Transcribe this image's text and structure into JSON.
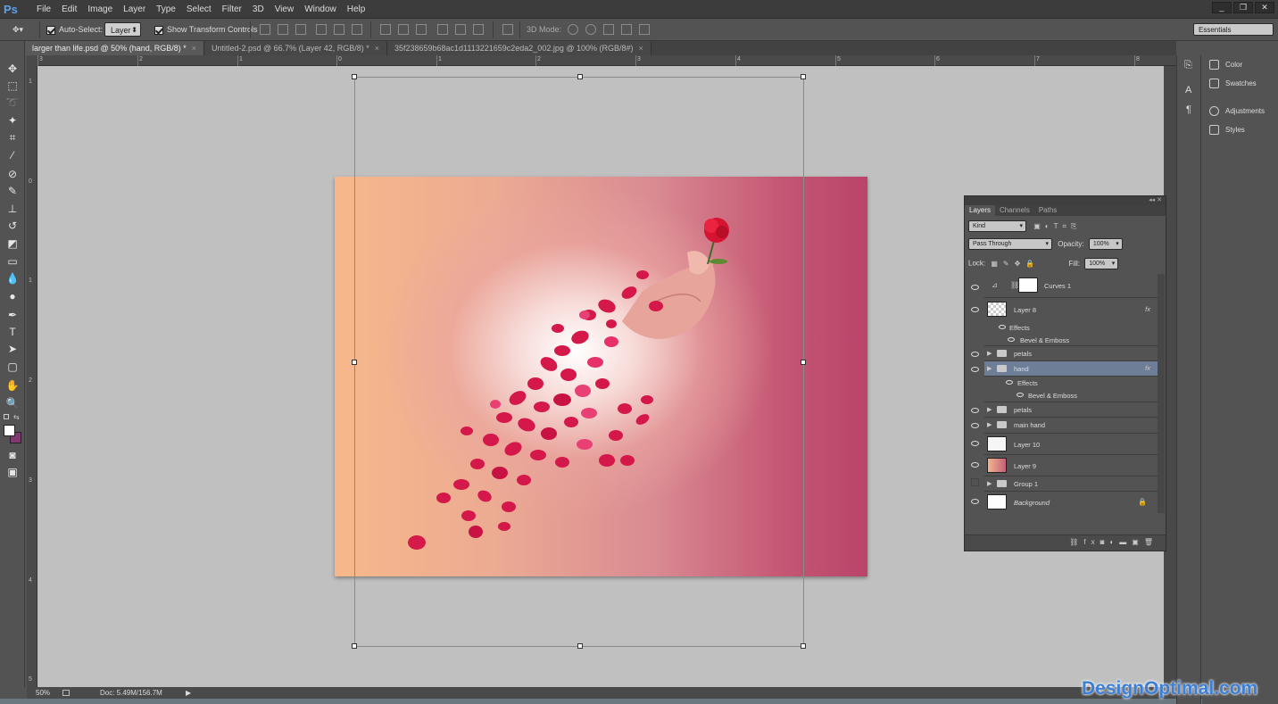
{
  "app": {
    "logo": "Ps"
  },
  "menu": [
    "File",
    "Edit",
    "Image",
    "Layer",
    "Type",
    "Select",
    "Filter",
    "3D",
    "View",
    "Window",
    "Help"
  ],
  "window_controls": [
    "_",
    "❐",
    "✕"
  ],
  "options": {
    "auto_select_label": "Auto-Select:",
    "auto_select_value": "Layer",
    "show_transform_label": "Show Transform Controls",
    "mode_3d_label": "3D Mode:",
    "workspace": "Essentials"
  },
  "tabs": [
    {
      "label": "larger than life.psd @ 50% (hand, RGB/8) *",
      "close": "×"
    },
    {
      "label": "Untitled-2.psd @ 66.7% (Layer 42, RGB/8) *",
      "close": "×"
    },
    {
      "label": "35f238659b68ac1d1113221659c2eda2_002.jpg @ 100% (RGB/8#)",
      "close": "×"
    }
  ],
  "ruler_top": [
    "3",
    "2",
    "1",
    "0",
    "1",
    "2",
    "3",
    "4",
    "5",
    "6",
    "7",
    "8"
  ],
  "ruler_left": [
    "1",
    "0",
    "1",
    "2",
    "3",
    "4",
    "5"
  ],
  "status": {
    "zoom": "50%",
    "doc": "Doc: 5.49M/156.7M"
  },
  "dock": [
    {
      "label": "Color",
      "icon": "color-icon"
    },
    {
      "label": "Swatches",
      "icon": "swatches-icon"
    },
    {
      "label": "Adjustments",
      "icon": "adjustments-icon"
    },
    {
      "label": "Styles",
      "icon": "styles-icon"
    }
  ],
  "layers_panel": {
    "tabs": [
      "Layers",
      "Channels",
      "Paths"
    ],
    "filter_kind": "Kind",
    "blend_mode": "Pass Through",
    "opacity_label": "Opacity:",
    "opacity_value": "100%",
    "lock_label": "Lock:",
    "fill_label": "Fill:",
    "fill_value": "100%",
    "layers": [
      {
        "name": "Curves 1",
        "type": "adjustment",
        "visible": true
      },
      {
        "name": "Layer 8",
        "type": "layer",
        "visible": true,
        "fx": "fx"
      },
      {
        "name": "Effects",
        "type": "effects",
        "visible": true
      },
      {
        "name": "Bevel & Emboss",
        "type": "effect",
        "visible": true
      },
      {
        "name": "petals",
        "type": "group",
        "visible": true
      },
      {
        "name": "hand",
        "type": "group",
        "visible": true,
        "fx": "fx",
        "selected": true
      },
      {
        "name": "Effects",
        "type": "effects",
        "visible": true
      },
      {
        "name": "Bevel & Emboss",
        "type": "effect",
        "visible": true
      },
      {
        "name": "petals",
        "type": "group",
        "visible": true
      },
      {
        "name": "main hand",
        "type": "group",
        "visible": true
      },
      {
        "name": "Layer 10",
        "type": "layer",
        "visible": true
      },
      {
        "name": "Layer 9",
        "type": "layer",
        "visible": true
      },
      {
        "name": "Group 1",
        "type": "group",
        "visible": false
      },
      {
        "name": "Background",
        "type": "background",
        "visible": true,
        "locked": true
      }
    ]
  },
  "watermark": "DesignOptimal.com"
}
